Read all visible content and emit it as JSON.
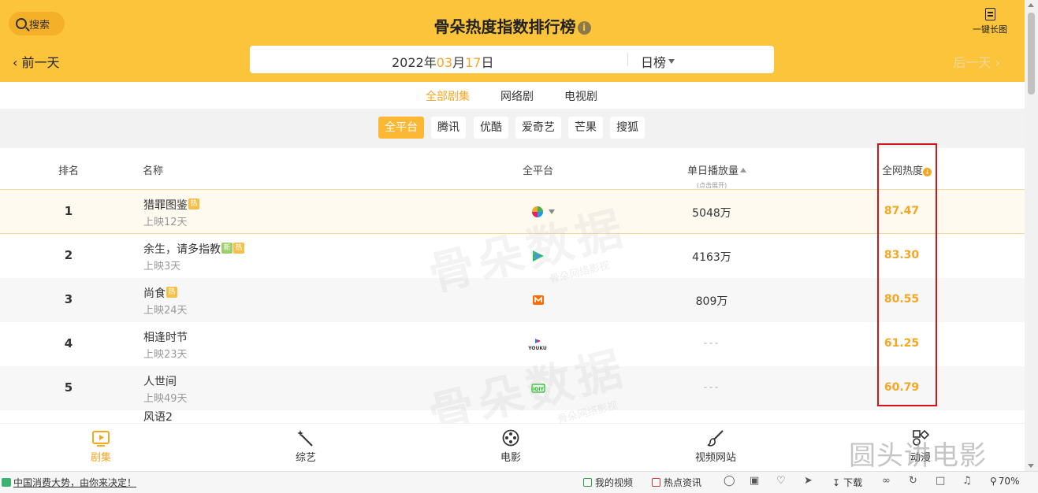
{
  "header": {
    "search_label": "搜索",
    "title": "骨朵热度指数排行榜",
    "info_glyph": "i",
    "longshot_label": "一键长图",
    "prev_label": "前一天",
    "next_label": "后一天",
    "date": {
      "year": "2022",
      "year_unit": "年",
      "month": "03",
      "month_unit": "月",
      "day": "17",
      "day_unit": "日"
    },
    "rank_type": "日榜"
  },
  "category_tabs": [
    {
      "label": "全部剧集",
      "active": true
    },
    {
      "label": "网络剧",
      "active": false
    },
    {
      "label": "电视剧",
      "active": false
    }
  ],
  "platform_tabs": [
    {
      "label": "全平台",
      "active": true
    },
    {
      "label": "腾讯",
      "active": false
    },
    {
      "label": "优酷",
      "active": false
    },
    {
      "label": "爱奇艺",
      "active": false
    },
    {
      "label": "芒果",
      "active": false
    },
    {
      "label": "搜狐",
      "active": false
    }
  ],
  "table": {
    "headers": {
      "rank": "排名",
      "name": "名称",
      "platform": "全平台",
      "plays": "单日播放量",
      "plays_hint": "(点击展开)",
      "heat": "全网热度"
    },
    "rows": [
      {
        "rank": "1",
        "name": "猎罪图鉴",
        "days": "上映12天",
        "tags": [
          "热"
        ],
        "platform_icon": "multi-platform-icon",
        "plays": "5048万",
        "heat": "87.47"
      },
      {
        "rank": "2",
        "name": "余生，请多指教",
        "days": "上映3天",
        "tags": [
          "新",
          "热"
        ],
        "platform_icon": "tencent-video-icon",
        "plays": "4163万",
        "heat": "83.30"
      },
      {
        "rank": "3",
        "name": "尚食",
        "days": "上映24天",
        "tags": [
          "热"
        ],
        "platform_icon": "mango-tv-icon",
        "plays": "809万",
        "heat": "80.55"
      },
      {
        "rank": "4",
        "name": "相逢时节",
        "days": "上映23天",
        "tags": [],
        "platform_icon": "youku-icon",
        "plays": "---",
        "heat": "61.25"
      },
      {
        "rank": "5",
        "name": "人世间",
        "days": "上映49天",
        "tags": [],
        "platform_icon": "iqiyi-icon",
        "plays": "---",
        "heat": "60.79"
      }
    ],
    "partial_row_name": "风语2"
  },
  "watermark": {
    "brand": "骨朵数据",
    "sub": "骨朵网络影视"
  },
  "bottom_nav": [
    {
      "label": "剧集",
      "icon": "tv-icon",
      "active": true
    },
    {
      "label": "综艺",
      "icon": "magic-wand-icon",
      "active": false
    },
    {
      "label": "电影",
      "icon": "film-reel-icon",
      "active": false
    },
    {
      "label": "视频网站",
      "icon": "brush-icon",
      "active": false
    },
    {
      "label": "动漫",
      "icon": "shapes-icon",
      "active": false
    }
  ],
  "corner_watermark": "圆头讲电影",
  "status_bar": {
    "news_text": "中国消费大势，由你来决定！",
    "my_video": "我的视频",
    "hot_news": "热点资讯",
    "download": "下载",
    "zoom": "70%"
  },
  "colors": {
    "header_bg": "#fcc43a",
    "accent": "#f5a623",
    "highlight_border": "#d4141a"
  }
}
